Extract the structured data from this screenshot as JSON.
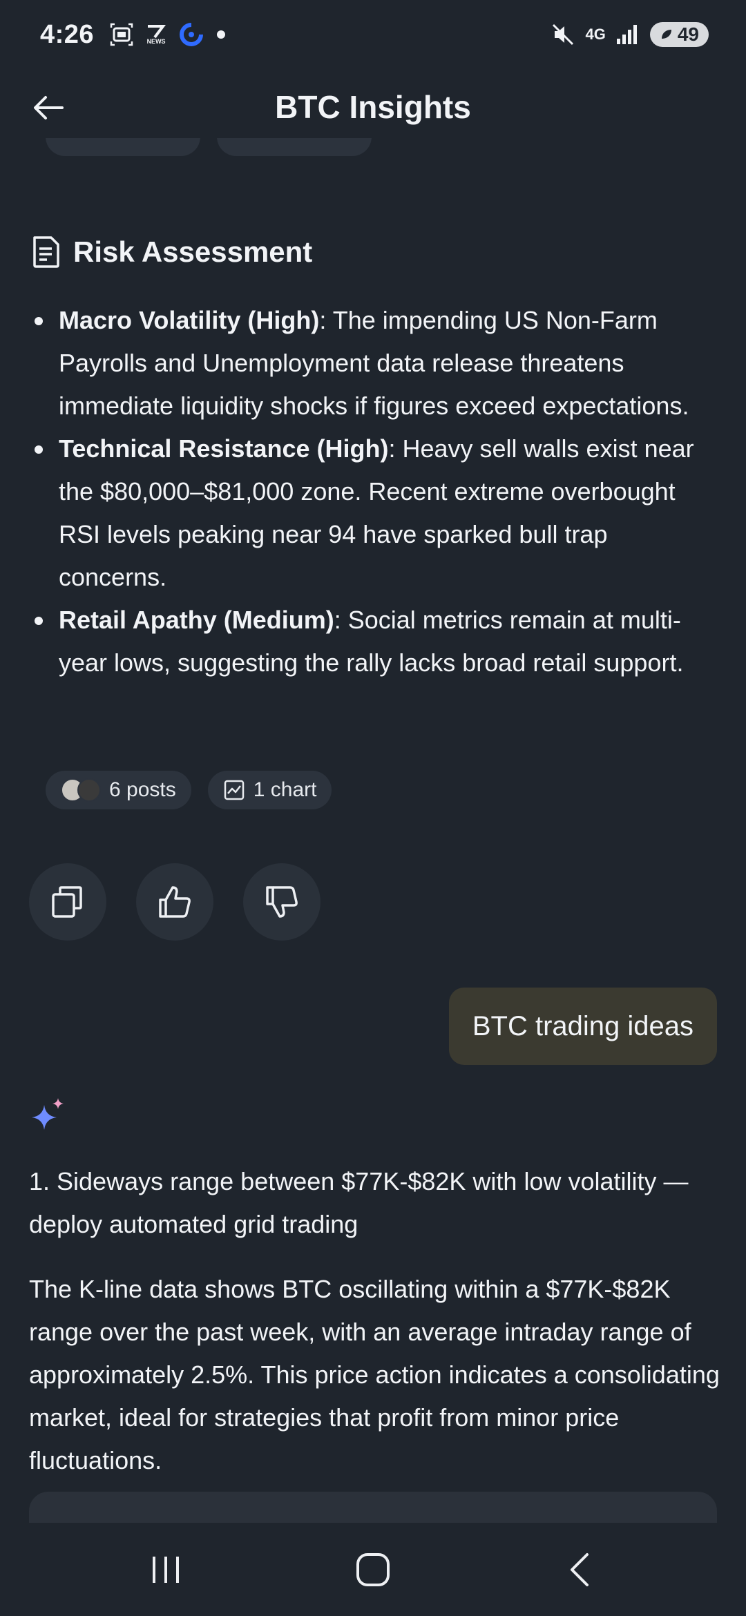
{
  "status_bar": {
    "time": "4:26",
    "news_badge": "NEWS",
    "network": "4G",
    "battery": "49"
  },
  "header": {
    "title": "BTC Insights"
  },
  "risk_section": {
    "title": "Risk Assessment",
    "items": [
      {
        "label": "Macro Volatility (High)",
        "text": ": The impending US Non-Farm Payrolls and Unemployment data release threatens immediate liquidity shocks if figures exceed expectations."
      },
      {
        "label": "Technical Resistance (High)",
        "text": ": Heavy sell walls exist near the $80,000–$81,000 zone. Recent extreme overbought RSI levels peaking near 94 have sparked bull trap concerns."
      },
      {
        "label": "Retail Apathy (Medium)",
        "text": ": Social metrics remain at multi-year lows, suggesting the rally lacks broad retail support."
      }
    ],
    "posts_chip": "6 posts",
    "chart_chip": "1 chart"
  },
  "chat": {
    "user_message": "BTC trading ideas",
    "answer_heading": "1. Sideways range between $77K-$82K with low volatility — deploy automated grid trading",
    "answer_body": "The K-line data shows BTC oscillating within a $77K-$82K range over the past week, with an average intraday range of approximately 2.5%. This price action indicates a consolidating market, ideal for strategies that profit from minor price fluctuations."
  },
  "icons": {
    "back": "arrow-left-icon",
    "section": "document-icon",
    "copy": "copy-icon",
    "like": "thumbs-up-icon",
    "dislike": "thumbs-down-icon",
    "ai": "sparkle-icon"
  },
  "colors": {
    "background": "#1f252d",
    "chip": "#2c333d",
    "user_bubble": "#3b3a30",
    "text": "#f2f4f7"
  }
}
